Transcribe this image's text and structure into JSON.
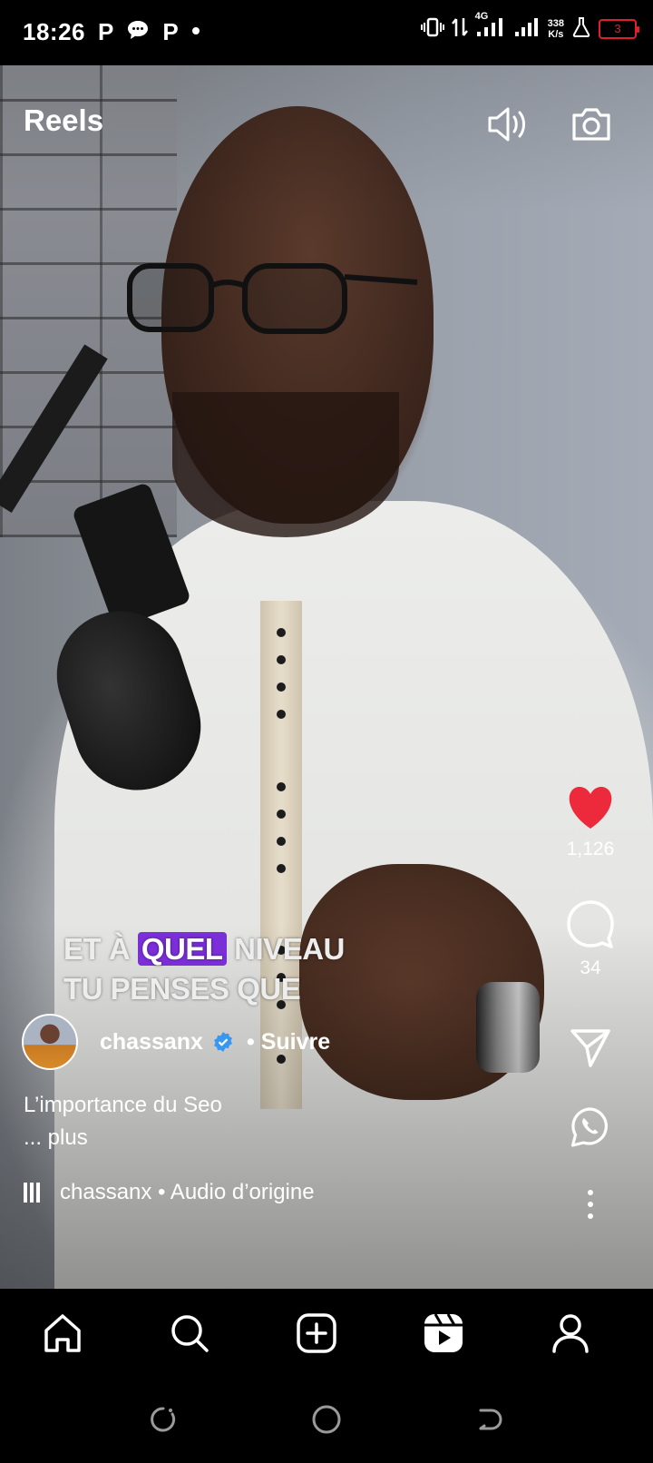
{
  "status_bar": {
    "time": "18:26",
    "left_icons": [
      "p-app-icon",
      "chat-bubble-icon",
      "p-app-icon",
      "dot"
    ],
    "p_glyph": "P",
    "network_type": "4G",
    "net_speed_value": "338",
    "net_speed_unit": "K/s",
    "battery_level": "3",
    "battery_color": "#e0202a"
  },
  "header": {
    "title": "Reels",
    "icons": [
      "speaker-icon",
      "camera-icon"
    ]
  },
  "video": {
    "subtitle_line1_before": "ET À ",
    "subtitle_highlight": "QUEL",
    "subtitle_line1_after": " NIVEAU",
    "subtitle_line2": "TU PENSES QUE",
    "highlight_color": "#7b2fd9"
  },
  "actions": {
    "like_count": "1,126",
    "like_color": "#ed2a3b",
    "comment_count": "34"
  },
  "author": {
    "username": "chassanx",
    "separator": "•",
    "follow_label": "Suivre",
    "verified_color": "#3897f0"
  },
  "caption": {
    "text": "L’importance du Seo",
    "more": "... plus"
  },
  "audio": {
    "label": "chassanx • Audio d’origine"
  },
  "bottom_nav": [
    "home-icon",
    "search-icon",
    "create-icon",
    "reels-icon",
    "profile-icon"
  ],
  "system_nav": [
    "recent-apps-icon",
    "home-circle-icon",
    "back-icon"
  ]
}
